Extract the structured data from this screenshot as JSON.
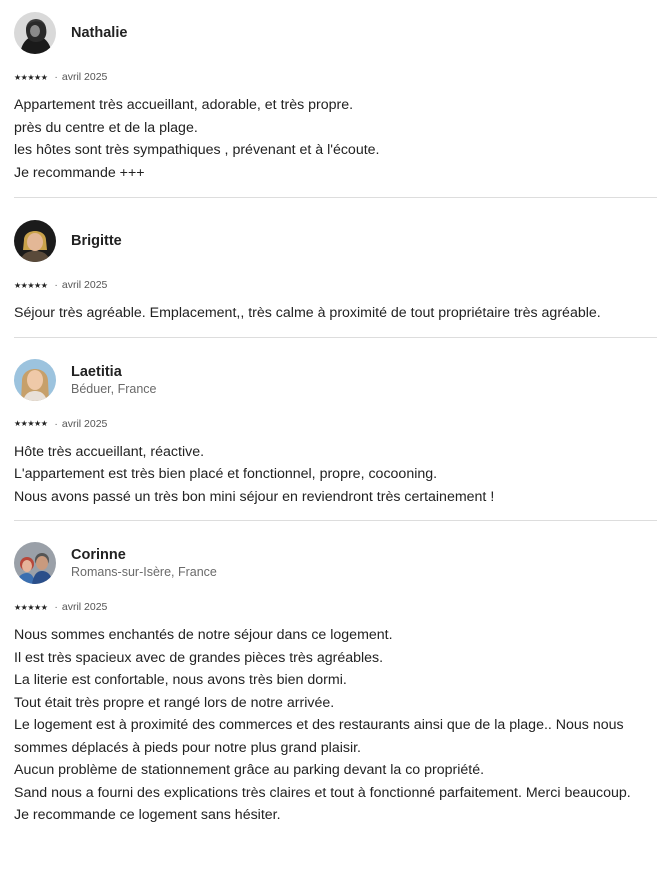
{
  "reviews": [
    {
      "name": "Nathalie",
      "location": "",
      "rating": "★★★★★",
      "date": "avril 2025",
      "text": "Appartement très accueillant, adorable, et très propre.\nprès du centre et de la plage.\nles hôtes sont très sympathiques , prévenant et à l'écoute.\nJe recommande +++"
    },
    {
      "name": "Brigitte",
      "location": "",
      "rating": "★★★★★",
      "date": "avril 2025",
      "text": "Séjour très agréable. Emplacement,, très calme à proximité de tout propriétaire très agréable."
    },
    {
      "name": "Laetitia",
      "location": "Béduer, France",
      "rating": "★★★★★",
      "date": "avril 2025",
      "text": "Hôte très accueillant, réactive.\nL'appartement est très bien placé et fonctionnel, propre, cocooning.\nNous avons passé un très bon mini séjour en reviendront très certainement !"
    },
    {
      "name": "Corinne",
      "location": "Romans-sur-Isère, France",
      "rating": "★★★★★",
      "date": "avril 2025",
      "text": "Nous sommes enchantés de notre séjour dans ce logement.\nIl est très spacieux avec de grandes pièces très agréables.\nLa literie est confortable, nous avons très bien dormi.\nTout était très propre et rangé lors de notre arrivée.\nLe logement est à proximité des commerces et des restaurants ainsi que de la plage.. Nous nous sommes déplacés à pieds pour notre plus grand plaisir.\nAucun problème de stationnement grâce au parking devant la co propriété.\nSand nous a fourni des explications très claires et tout à fonctionné parfaitement. Merci beaucoup.\nJe recommande ce logement sans hésiter."
    }
  ],
  "separator_char": "·"
}
